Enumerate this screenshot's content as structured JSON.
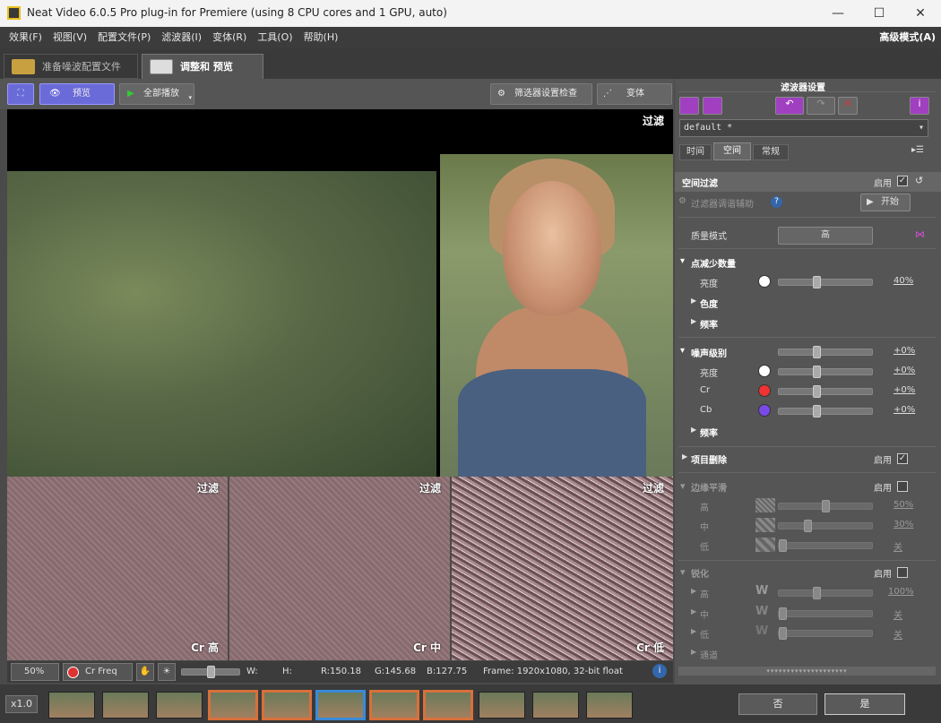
{
  "window": {
    "title": "Neat Video 6.0.5 Pro plug-in for Premiere (using 8 CPU cores and 1 GPU, auto)",
    "min": "—",
    "max": "☐",
    "close": "✕"
  },
  "menu": {
    "items": [
      "效果(F)",
      "视图(V)",
      "配置文件(P)",
      "滤波器(I)",
      "变体(R)",
      "工具(O)",
      "帮助(H)"
    ],
    "mode": "高级模式(A)"
  },
  "tabs": {
    "prepare": "准备噪波配置文件",
    "adjust": "调整和 预览"
  },
  "toolbar": {
    "preview": "预览",
    "play_all": "全部播放",
    "filter_check": "筛选器设置检查",
    "variants": "变体"
  },
  "viewer": {
    "filter_label": "过滤",
    "cr_high": "Cr 高",
    "cr_mid": "Cr 中",
    "cr_low": "Cr 低"
  },
  "status": {
    "zoom": "50%",
    "channel": "Cr Freq",
    "w": "W:",
    "h": "H:",
    "r": "R:150.18",
    "g": "G:145.68",
    "b": "B:127.75",
    "frame": "Frame: 1920x1080, 32-bit float"
  },
  "filmstrip": {
    "speed": "x1.0",
    "cancel": "否",
    "ok": "是"
  },
  "panel": {
    "title": "滤波器设置",
    "preset": "default *",
    "tabs": [
      "时间",
      "空间",
      "常规"
    ],
    "spatial_filter": "空间过滤",
    "enable": "启用",
    "tuning": "过滤器调谐辅助",
    "start": "开始",
    "quality_label": "质量模式",
    "quality_value": "高",
    "noise_reduction": "点减少数量",
    "luma": "亮度",
    "luma_val": "40%",
    "chroma": "色度",
    "freq": "频率",
    "noise_level": "噪声级别",
    "nl_val": "+0%",
    "nl_luma": "亮度",
    "nl_luma_val": "+0%",
    "cr": "Cr",
    "cr_val": "+0%",
    "cb": "Cb",
    "cb_val": "+0%",
    "nl_freq": "频率",
    "artifact": "项目删除",
    "edge": "边缘平滑",
    "high": "高",
    "mid": "中",
    "low": "低",
    "edge_high_val": "50%",
    "edge_mid_val": "30%",
    "edge_low_val": "关",
    "sharpen": "锐化",
    "sh_high_val": "100%",
    "sh_mid_val": "关",
    "sh_low_val": "关",
    "channel": "通道"
  },
  "colors": {
    "accent": "#6a6ad8",
    "selected_frame": "#d8703a",
    "current_frame": "#3a8ad8"
  }
}
